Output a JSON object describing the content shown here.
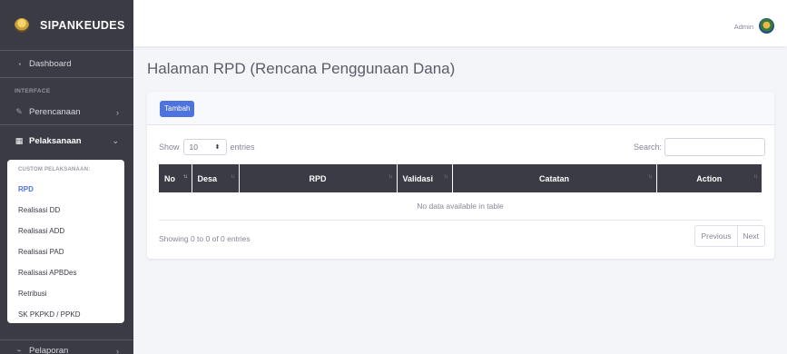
{
  "brand": {
    "name": "SIPANKEUDES"
  },
  "sidebar": {
    "dashboard": "Dashboard",
    "interface_heading": "INTERFACE",
    "perencanaan": "Perencanaan",
    "pelaksanaan": "Pelaksanaan",
    "pelaporan": "Pelaporan",
    "submenu": {
      "heading": "CUSTOM PELAKSANAAN:",
      "items": [
        "RPD",
        "Realisasi DD",
        "Realisasi ADD",
        "Realisasi PAD",
        "Realisasi APBDes",
        "Retribusi",
        "SK PKPKD / PPKD"
      ]
    }
  },
  "topbar": {
    "user": "Admin"
  },
  "page": {
    "title": "Halaman RPD (Rencana Penggunaan Dana)",
    "add_button": "Tambah",
    "show_label": "Show",
    "entries_value": "10",
    "entries_label": "entries",
    "search_label": "Search:",
    "columns": [
      "No",
      "Desa",
      "RPD",
      "Validasi",
      "Catatan",
      "Action"
    ],
    "empty_text": "No data available in table",
    "info_text": "Showing 0 to 0 of 0 entries",
    "prev_label": "Previous",
    "next_label": "Next"
  },
  "colors": {
    "sidebar": "#3a3b45",
    "accent": "#4e73df",
    "background": "#f4f5f8"
  }
}
